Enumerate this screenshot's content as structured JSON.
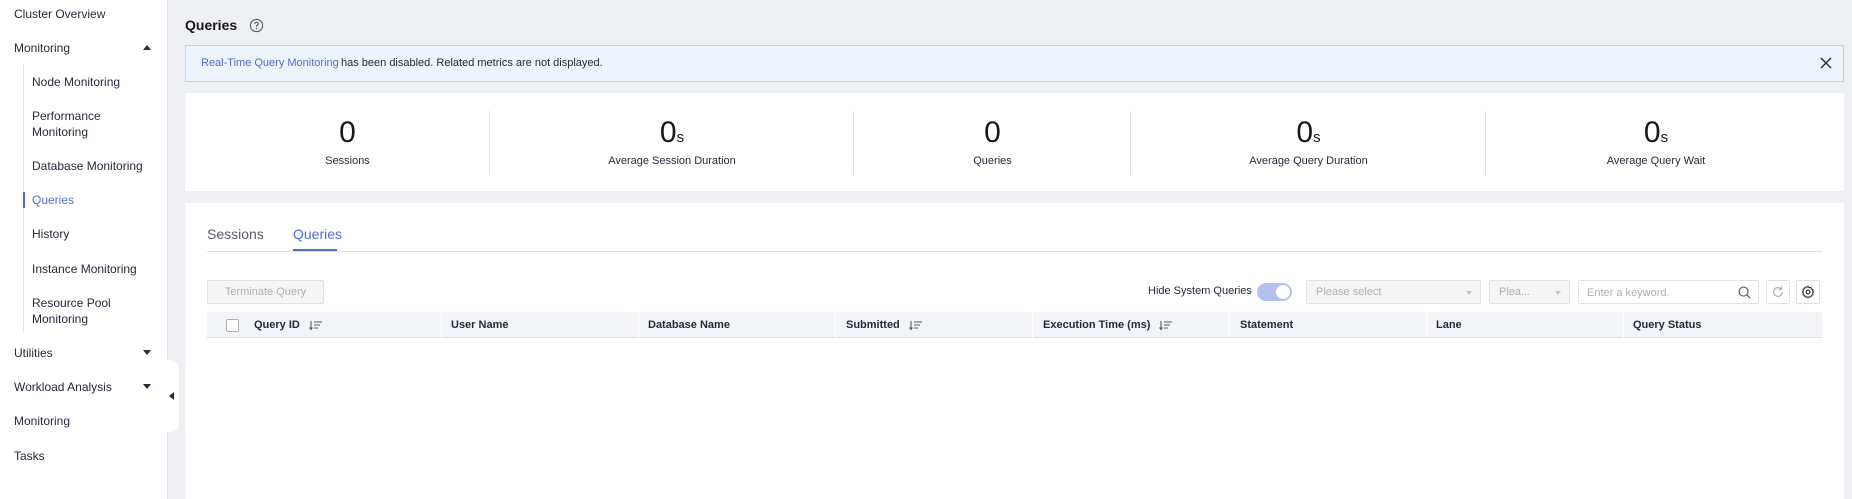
{
  "sidebar": {
    "items": [
      {
        "label": "Cluster Overview"
      },
      {
        "label": "Monitoring"
      },
      {
        "label": "Node Monitoring"
      },
      {
        "label": "Performance Monitoring"
      },
      {
        "label": "Database Monitoring"
      },
      {
        "label": "Queries"
      },
      {
        "label": "History"
      },
      {
        "label": "Instance Monitoring"
      },
      {
        "label": "Resource Pool Monitoring"
      },
      {
        "label": "Utilities"
      },
      {
        "label": "Workload Analysis"
      },
      {
        "label": "Monitoring"
      },
      {
        "label": "Tasks"
      }
    ],
    "active_item": "Queries"
  },
  "header": {
    "title": "Queries"
  },
  "banner": {
    "link_text": "Real-Time Query Monitoring",
    "message": "has been disabled. Related metrics are not displayed."
  },
  "stats": [
    {
      "value": "0",
      "unit": "",
      "label": "Sessions"
    },
    {
      "value": "0",
      "unit": "s",
      "label": "Average Session Duration"
    },
    {
      "value": "0",
      "unit": "",
      "label": "Queries"
    },
    {
      "value": "0",
      "unit": "s",
      "label": "Average Query Duration"
    },
    {
      "value": "0",
      "unit": "s",
      "label": "Average Query Wait"
    }
  ],
  "tabs": [
    {
      "label": "Sessions"
    },
    {
      "label": "Queries"
    }
  ],
  "active_tab": "Queries",
  "toolbar": {
    "terminate_label": "Terminate Query",
    "hide_system_label": "Hide System Queries",
    "hide_system_enabled": true,
    "select_placeholder": "Please select",
    "select2_placeholder": "Plea...",
    "search_placeholder": "Enter a keyword."
  },
  "table": {
    "columns": [
      {
        "label": "Query ID",
        "sortable": true
      },
      {
        "label": "User Name",
        "sortable": false
      },
      {
        "label": "Database Name",
        "sortable": false
      },
      {
        "label": "Submitted",
        "sortable": true
      },
      {
        "label": "Execution Time (ms)",
        "sortable": true
      },
      {
        "label": "Statement",
        "sortable": false
      },
      {
        "label": "Lane",
        "sortable": false
      },
      {
        "label": "Query Status",
        "sortable": false
      }
    ],
    "rows": []
  },
  "colors": {
    "accent": "#526ecc",
    "banner_bg": "#edf4fb",
    "toggle_on": "#b3c1ee"
  }
}
